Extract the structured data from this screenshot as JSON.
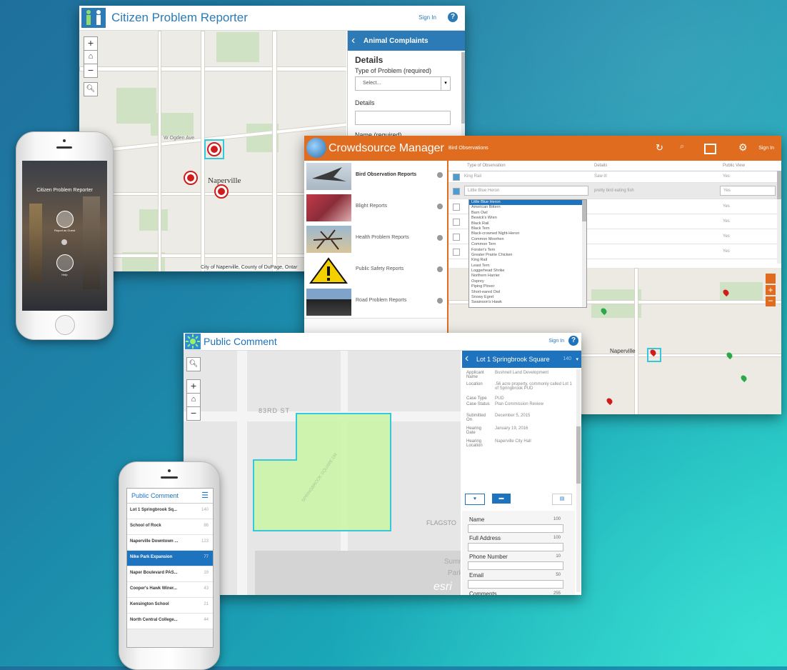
{
  "citizen": {
    "title": "Citizen Problem Reporter",
    "sign_in": "Sign In",
    "panel_header": "Animal Complaints",
    "section": "Details",
    "type_label": "Type of Problem (required)",
    "type_placeholder": "Select...",
    "details_label": "Details",
    "name_label": "Name (required)",
    "attribution": "City of Naperville, County of DuPage, Ontar",
    "map_labels": [
      "Naperville",
      "W Ogden Ave"
    ]
  },
  "crowd": {
    "title": "Crowdsource Manager",
    "tab": "Bird Observations",
    "sign_in": "Sign In",
    "columns": [
      "Type of Observation",
      "Details",
      "Public View"
    ],
    "items": [
      {
        "label": "Bird Observation Reports"
      },
      {
        "label": "Blight Reports"
      },
      {
        "label": "Health Problem Reports"
      },
      {
        "label": "Public Safety Reports"
      },
      {
        "label": "Road Problem Reports"
      }
    ],
    "rows": [
      {
        "type": "King Rail",
        "details": "Saw it!",
        "public": "Yes"
      },
      {
        "type": "Little Blue Heron",
        "details": "pretty bird eating fish",
        "public": "Yes"
      },
      {
        "type": "",
        "details": "",
        "public": "Yes"
      },
      {
        "type": "",
        "details": "",
        "public": "Yes"
      },
      {
        "type": "",
        "details": "",
        "public": "Yes"
      },
      {
        "type": "",
        "details": "",
        "public": "Yes"
      }
    ],
    "dropdown_options": [
      "Little Blue Heron",
      "American Bittern",
      "Barn Owl",
      "Bewick's Wren",
      "Black Rail",
      "Black Tern",
      "Black-crowned Night-Heron",
      "Common Moorhen",
      "Common Tern",
      "Forster's Tern",
      "Greater Prairie Chicken",
      "King Rail",
      "Least Tern",
      "Loggerhead Shrike",
      "Northern Harrier",
      "Osprey",
      "Piping Plover",
      "Short-eared Owl",
      "Snowy Egret",
      "Swainson's Hawk"
    ],
    "map_label": "Naperville"
  },
  "citizen_phone": {
    "title": "Citizen Problem Reporter",
    "button1": "Report as Guest",
    "button2": "Help"
  },
  "public": {
    "title": "Public Comment",
    "sign_in": "Sign In",
    "panel_title": "Lot 1 Springbrook Square",
    "panel_count": "140",
    "details": [
      {
        "k": "Applicant Name",
        "v": "Bushnell Land Development"
      },
      {
        "k": "Location",
        "v": ".56 acre property, commonly called Lot 1 of Springbrook PUD"
      },
      {
        "k": "Case Type",
        "v": "PUD"
      },
      {
        "k": "Case Status",
        "v": "Plan Commission Review"
      },
      {
        "k": "Submitted On",
        "v": "December 5, 2015"
      },
      {
        "k": "Hearing Date",
        "v": "January 19, 2016"
      },
      {
        "k": "Hearing Location",
        "v": "Naperville City Hall"
      }
    ],
    "form": [
      {
        "label": "Name",
        "max": "100"
      },
      {
        "label": "Full Address",
        "max": "100"
      },
      {
        "label": "Phone Number",
        "max": "10"
      },
      {
        "label": "Email",
        "max": "50"
      },
      {
        "label": "Comments",
        "max": "255"
      }
    ],
    "map_labels": [
      "83RD ST",
      "FLAGSTO",
      "Summer",
      "Park",
      "esri",
      "SPRINGBROOK SQUARE DR"
    ]
  },
  "public_phone": {
    "title": "Public Comment",
    "items": [
      {
        "name": "Lot 1 Springbrook Sq...",
        "count": "140"
      },
      {
        "name": "School of Rock",
        "count": "86"
      },
      {
        "name": "Naperville Downtown ...",
        "count": "123"
      },
      {
        "name": "Nike Park Expansion",
        "count": "77"
      },
      {
        "name": "Naper Boulevard PAS...",
        "count": "19"
      },
      {
        "name": "Cooper's Hawk Winer...",
        "count": "43"
      },
      {
        "name": "Kensington School",
        "count": "21"
      },
      {
        "name": "North Central College...",
        "count": "44"
      }
    ],
    "selected_index": 3
  },
  "colors": {
    "citizen_blue": "#2c7bb6",
    "crowd_orange": "#e06d1f",
    "public_blue": "#1e73be",
    "selected_row": "#1e73be",
    "marker_red": "#d01c1c",
    "polygon_green": "#c8f5a5",
    "polygon_border": "#34c8d8"
  }
}
